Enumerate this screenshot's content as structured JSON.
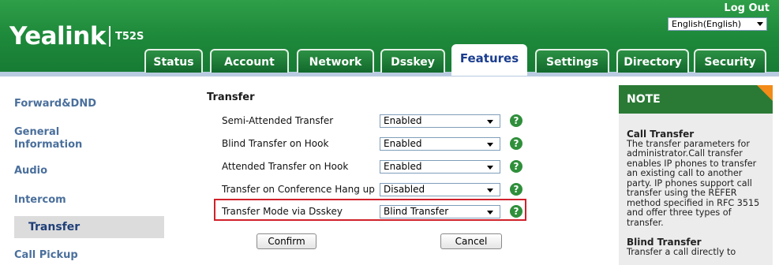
{
  "header": {
    "brand": "Yealink",
    "model": "T52S",
    "logout": "Log Out",
    "language": "English(English)"
  },
  "tabs": [
    {
      "label": "Status"
    },
    {
      "label": "Account"
    },
    {
      "label": "Network"
    },
    {
      "label": "Dsskey"
    },
    {
      "label": "Features"
    },
    {
      "label": "Settings"
    },
    {
      "label": "Directory"
    },
    {
      "label": "Security"
    }
  ],
  "active_tab": "Features",
  "sidebar": {
    "items": [
      {
        "label": "Forward&DND"
      },
      {
        "label": "General Information"
      },
      {
        "label": "Audio"
      },
      {
        "label": "Intercom"
      },
      {
        "label": "Transfer"
      },
      {
        "label": "Call Pickup"
      }
    ],
    "selected": "Transfer"
  },
  "main": {
    "section_title": "Transfer",
    "rows": [
      {
        "label": "Semi-Attended Transfer",
        "value": "Enabled"
      },
      {
        "label": "Blind Transfer on Hook",
        "value": "Enabled"
      },
      {
        "label": "Attended Transfer on Hook",
        "value": "Enabled"
      },
      {
        "label": "Transfer on Conference Hang up",
        "value": "Disabled"
      },
      {
        "label": "Transfer Mode via Dsskey",
        "value": "Blind Transfer"
      }
    ],
    "help_glyph": "?",
    "confirm_label": "Confirm",
    "cancel_label": "Cancel"
  },
  "note": {
    "title": "NOTE",
    "sections": [
      {
        "heading": "Call Transfer",
        "text": "The transfer parameters for administrator.Call transfer enables IP phones to transfer an existing call to another party. IP phones support call transfer using the REFER method specified in RFC 3515 and offer three types of transfer."
      },
      {
        "heading": "Blind Transfer",
        "text": "Transfer a call directly to"
      }
    ]
  },
  "colors": {
    "header_green": "#1e8a3b",
    "note_green": "#2a7a35",
    "accent_orange": "#f28b18",
    "highlight_red": "#d0212a",
    "sidebar_text": "#4a6f9c"
  }
}
